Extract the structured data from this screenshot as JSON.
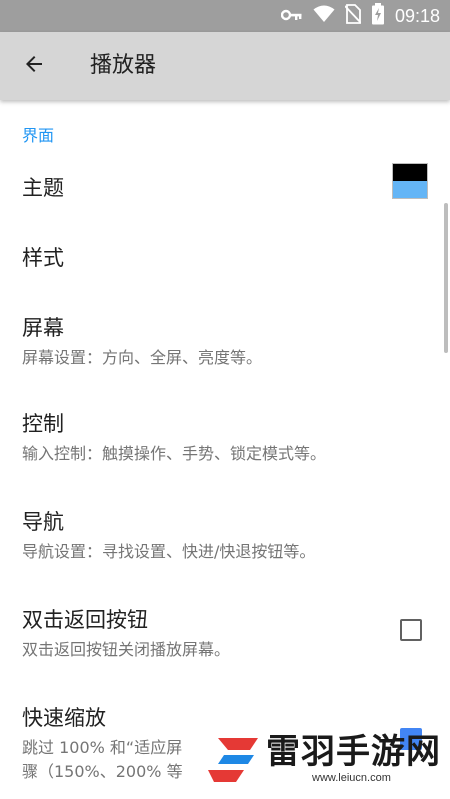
{
  "status_bar": {
    "time": "09:18",
    "icons": [
      "key-icon",
      "wifi-icon",
      "no-sim-icon",
      "battery-charging-icon"
    ]
  },
  "app_bar": {
    "title": "播放器",
    "back_icon": "arrow-back-icon"
  },
  "category": {
    "label": "界面"
  },
  "preferences": [
    {
      "title": "主题",
      "summary": "",
      "widget": "color-swatch",
      "swatch_colors": [
        "#000000",
        "#64b5f6"
      ]
    },
    {
      "title": "样式",
      "summary": ""
    },
    {
      "title": "屏幕",
      "summary": "屏幕设置：方向、全屏、亮度等。"
    },
    {
      "title": "控制",
      "summary": "输入控制：触摸操作、手势、锁定模式等。"
    },
    {
      "title": "导航",
      "summary": "导航设置：寻找设置、快进/快退按钮等。"
    },
    {
      "title": "双击返回按钮",
      "summary": "双击返回按钮关闭播放屏幕。",
      "widget": "checkbox",
      "checked": false
    },
    {
      "title": "快速缩放",
      "summary_line1": "跳过 100% 和“适应屏",
      "summary_line2": "骤（150%、200% 等",
      "widget": "checkbox",
      "checked": true
    }
  ],
  "watermark": {
    "text": "雷羽手游网",
    "url": "www.leiucn.com"
  },
  "colors": {
    "accent": "#2196f3",
    "checkbox_checked": "#4285f4",
    "appbar": "#d6d6d6",
    "statusbar": "#9e9e9e"
  }
}
